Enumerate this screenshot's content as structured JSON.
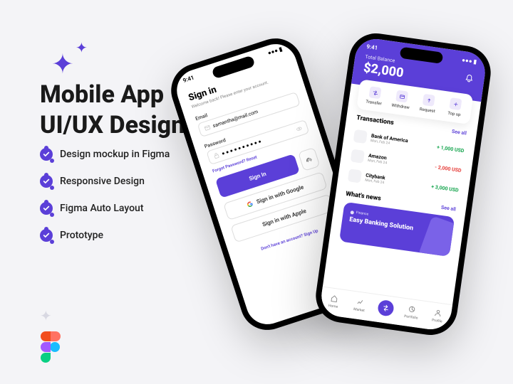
{
  "heading_line1": "Mobile App",
  "heading_line2": "UI/UX Design",
  "features": [
    "Design mockup in Figma",
    "Responsive Design",
    "Figma Auto Layout",
    "Prototype"
  ],
  "phone1": {
    "time": "9:41",
    "title": "Sign in",
    "subtitle": "Welcome back! Please enter your account.",
    "email_label": "Email",
    "email_value": "samantha@mail.com",
    "password_label": "Password",
    "password_value": "● ● ● ● ● ● ● ● ● ●",
    "forgot_prefix": "Forgot Password? ",
    "forgot_link": "Reset",
    "signin_btn": "Sign In",
    "google_btn": "Sign in with Google",
    "apple_btn": "Sign in with Apple",
    "noacct_prefix": "Don't have an account? ",
    "noacct_link": "Sign Up"
  },
  "phone2": {
    "time": "9:41",
    "balance_label": "Total Balance",
    "balance": "$2,000",
    "actions": [
      "Transfer",
      "Withdraw",
      "Request",
      "Top up"
    ],
    "transactions_title": "Transactions",
    "seeall": "See all",
    "txns": [
      {
        "name": "Bank of America",
        "date": "Mon, Feb 24",
        "amount": "+ 1,000 USD",
        "pos": true
      },
      {
        "name": "Amazon",
        "date": "Mon, Feb 24",
        "amount": "- 2,000 USD",
        "pos": false
      },
      {
        "name": "Citybank",
        "date": "Mon, Feb 24",
        "amount": "+ 3,000 USD",
        "pos": true
      }
    ],
    "news_title": "What's news",
    "news_tag": "Finance",
    "news_headline": "Easy Banking Solution",
    "nav": [
      "Home",
      "Market",
      "",
      "Portfolio",
      "Profile"
    ]
  }
}
